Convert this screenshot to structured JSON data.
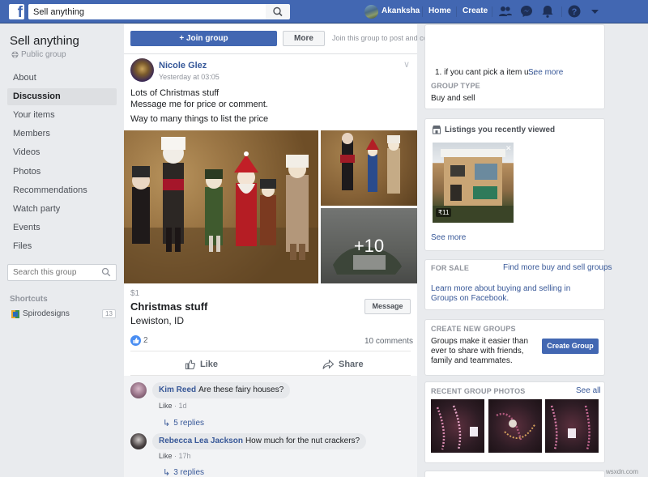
{
  "topbar": {
    "logo": "f",
    "search_value": "Sell anything",
    "user_name": "Akanksha",
    "home": "Home",
    "create": "Create"
  },
  "group": {
    "title": "Sell anything",
    "type": "Public group"
  },
  "nav": {
    "items": [
      {
        "label": "About",
        "active": false
      },
      {
        "label": "Discussion",
        "active": true
      },
      {
        "label": "Your items",
        "active": false
      },
      {
        "label": "Members",
        "active": false
      },
      {
        "label": "Videos",
        "active": false
      },
      {
        "label": "Photos",
        "active": false
      },
      {
        "label": "Recommendations",
        "active": false
      },
      {
        "label": "Watch party",
        "active": false
      },
      {
        "label": "Events",
        "active": false
      },
      {
        "label": "Files",
        "active": false
      }
    ],
    "search_placeholder": "Search this group",
    "shortcuts_heading": "Shortcuts",
    "shortcut": {
      "label": "Spirodesigns",
      "count": "13"
    }
  },
  "join": {
    "button": "+ Join group",
    "more": "More",
    "message": "Join this group to post and comment."
  },
  "post": {
    "author": "Nicole Glez",
    "time": "Yesterday at 03:05",
    "lines": [
      "Lots of Christmas stuff",
      "Message me for price or comment.",
      "Way to many things to list the price"
    ],
    "more_photos": "+10",
    "price": "$1",
    "title": "Christmas stuff",
    "location": "Lewiston, ID",
    "message_button": "Message",
    "likes": "2",
    "comments_count": "10 comments",
    "like_action": "Like",
    "share_action": "Share"
  },
  "comments": [
    {
      "name": "Kim Reed",
      "text": "Are these fairy houses?",
      "like": "Like",
      "age": "1d",
      "replies": "5 replies"
    },
    {
      "name": "Rebecca Lea Jackson",
      "text": "How much for the nut crackers?",
      "like": "Like",
      "age": "17h",
      "replies": "3 replies"
    }
  ],
  "right": {
    "top_text": "1. if you cant pick a item u...",
    "see_more": "See more",
    "group_type_heading": "GROUP TYPE",
    "group_type_value": "Buy and sell",
    "listings_heading": "Listings you recently viewed",
    "listing_price": "₹11",
    "listings_see_more": "See more",
    "for_sale_heading": "FOR SALE",
    "find_more": "Find more buy and sell groups",
    "learn_more": "Learn more about buying and selling in Groups on Facebook.",
    "create_heading": "CREATE NEW GROUPS",
    "create_text": "Groups make it easier than ever to share with friends, family and teammates.",
    "create_button": "Create Group",
    "recent_photos_heading": "RECENT GROUP PHOTOS",
    "see_all": "See all"
  },
  "watermark": "wsxdn.com",
  "colors": {
    "brand": "#4267b2",
    "link": "#385898",
    "background": "#e9ebee"
  }
}
